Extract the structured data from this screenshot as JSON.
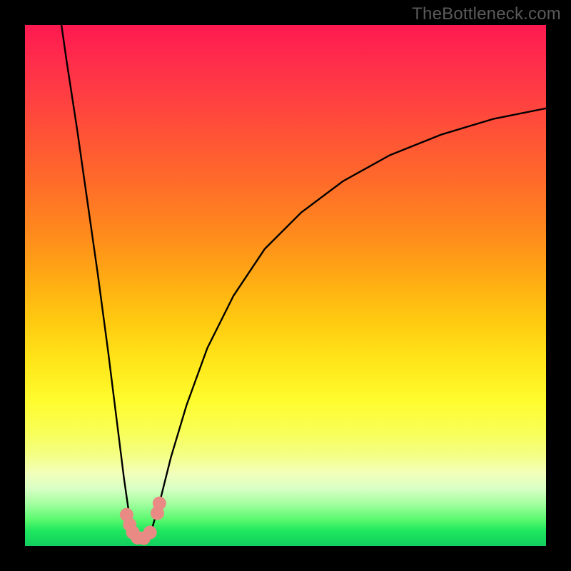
{
  "watermark": "TheBottleneck.com",
  "colors": {
    "frame": "#000000",
    "curve": "#000000",
    "marker": "#e98b84"
  },
  "chart_data": {
    "type": "line",
    "title": "",
    "xlabel": "",
    "ylabel": "",
    "xlim": [
      0,
      100
    ],
    "ylim": [
      0,
      100
    ],
    "grid": false,
    "legend": false,
    "note": "Values are approximate, read from pixel positions; y is % height from bottom (0 = bottom green, 100 = top red).",
    "series": [
      {
        "name": "left-branch",
        "x": [
          7,
          8,
          10,
          12,
          14,
          16,
          17,
          18,
          19,
          20,
          21
        ],
        "y": [
          100,
          93,
          80,
          66,
          52,
          37,
          29,
          21,
          13,
          6,
          1
        ]
      },
      {
        "name": "right-branch",
        "x": [
          24,
          26,
          28,
          31,
          35,
          40,
          46,
          53,
          61,
          70,
          80,
          90,
          100
        ],
        "y": [
          2,
          9,
          17,
          27,
          38,
          48,
          57,
          64,
          70,
          75,
          79,
          82,
          84
        ]
      }
    ],
    "markers": [
      {
        "x": 19.5,
        "y": 6.0
      },
      {
        "x": 20.1,
        "y": 4.1
      },
      {
        "x": 20.7,
        "y": 2.6
      },
      {
        "x": 21.6,
        "y": 1.6
      },
      {
        "x": 22.8,
        "y": 1.5
      },
      {
        "x": 24.0,
        "y": 2.6
      },
      {
        "x": 25.4,
        "y": 6.3
      },
      {
        "x": 25.8,
        "y": 8.2
      }
    ]
  }
}
